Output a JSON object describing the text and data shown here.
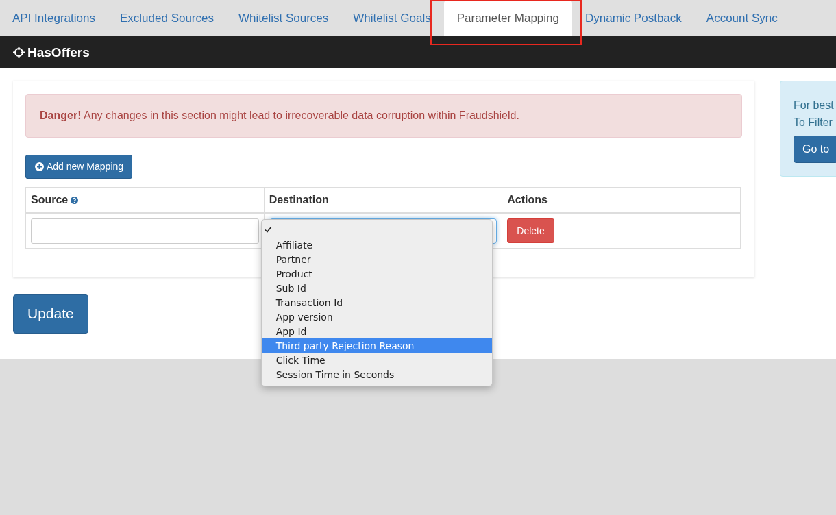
{
  "tabs": [
    {
      "label": "API Integrations",
      "selected": false,
      "highlighted": false
    },
    {
      "label": "Excluded Sources",
      "selected": false,
      "highlighted": false
    },
    {
      "label": "Whitelist Sources",
      "selected": false,
      "highlighted": false
    },
    {
      "label": "Whitelist Goals",
      "selected": false,
      "highlighted": false
    },
    {
      "label": "Parameter Mapping",
      "selected": true,
      "highlighted": true
    },
    {
      "label": "Dynamic Postback",
      "selected": false,
      "highlighted": false
    },
    {
      "label": "Account Sync",
      "selected": false,
      "highlighted": false
    }
  ],
  "brand": {
    "name": "HasOffers"
  },
  "alert": {
    "text": "**Danger!** Any changes in this section might lead to irrecoverable data corruption within Fraudshield."
  },
  "add_button": {
    "label": "Add new Mapping"
  },
  "table": {
    "columns": [
      "Source",
      "Destination",
      "Actions"
    ],
    "rows": [
      {
        "delete_label": "Delete"
      }
    ]
  },
  "dropdown": {
    "options": [
      {
        "checked": true,
        "selected": false
      },
      {
        "label": "Affiliate",
        "checked": false,
        "selected": false
      },
      {
        "label": "Partner",
        "checked": false,
        "selected": false
      },
      {
        "label": "Product",
        "checked": false,
        "selected": false
      },
      {
        "label": "Sub Id",
        "checked": false,
        "selected": false
      },
      {
        "label": "Transaction Id",
        "checked": false,
        "selected": false
      },
      {
        "label": "App version",
        "checked": false,
        "selected": false
      },
      {
        "label": "App Id",
        "checked": false,
        "selected": false
      },
      {
        "label": "Third party Rejection Reason",
        "checked": false,
        "selected": true
      },
      {
        "label": "Click Time",
        "checked": false,
        "selected": false
      },
      {
        "label": "Session Time in Seconds",
        "checked": false,
        "selected": false
      }
    ]
  },
  "update_button": {
    "label": "Update"
  },
  "info_panel": {
    "lines": [
      "For best",
      "To Filter"
    ],
    "button": "Go to"
  }
}
